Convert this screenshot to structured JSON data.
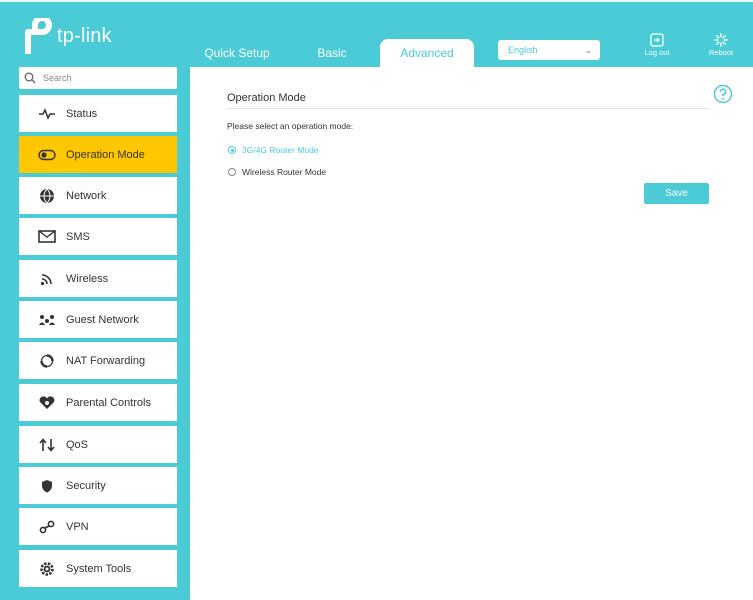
{
  "brand": {
    "name": "tp-link"
  },
  "nav": {
    "tabs": [
      {
        "label": "Quick Setup"
      },
      {
        "label": "Basic"
      },
      {
        "label": "Advanced"
      }
    ],
    "language": "English",
    "logout_label": "Log out",
    "reboot_label": "Reboot"
  },
  "sidebar": {
    "search_placeholder": "Search",
    "items": [
      {
        "label": "Status",
        "icon": "pulse-icon"
      },
      {
        "label": "Operation Mode",
        "icon": "toggle-icon"
      },
      {
        "label": "Network",
        "icon": "globe-icon"
      },
      {
        "label": "SMS",
        "icon": "envelope-icon"
      },
      {
        "label": "Wireless",
        "icon": "wifi-icon"
      },
      {
        "label": "Guest Network",
        "icon": "guests-icon"
      },
      {
        "label": "NAT Forwarding",
        "icon": "nat-icon"
      },
      {
        "label": "Parental Controls",
        "icon": "heart-icon"
      },
      {
        "label": "QoS",
        "icon": "arrows-icon"
      },
      {
        "label": "Security",
        "icon": "shield-icon"
      },
      {
        "label": "VPN",
        "icon": "key-icon"
      },
      {
        "label": "System Tools",
        "icon": "gear-icon"
      }
    ]
  },
  "main": {
    "title": "Operation Mode",
    "prompt": "Please select an operation mode:",
    "options": [
      {
        "label": "3G/4G Router Mode",
        "selected": true
      },
      {
        "label": "Wireless Router Mode",
        "selected": false
      }
    ],
    "save_label": "Save"
  },
  "colors": {
    "accent": "#4acbd6",
    "active_item": "#ffc700"
  }
}
